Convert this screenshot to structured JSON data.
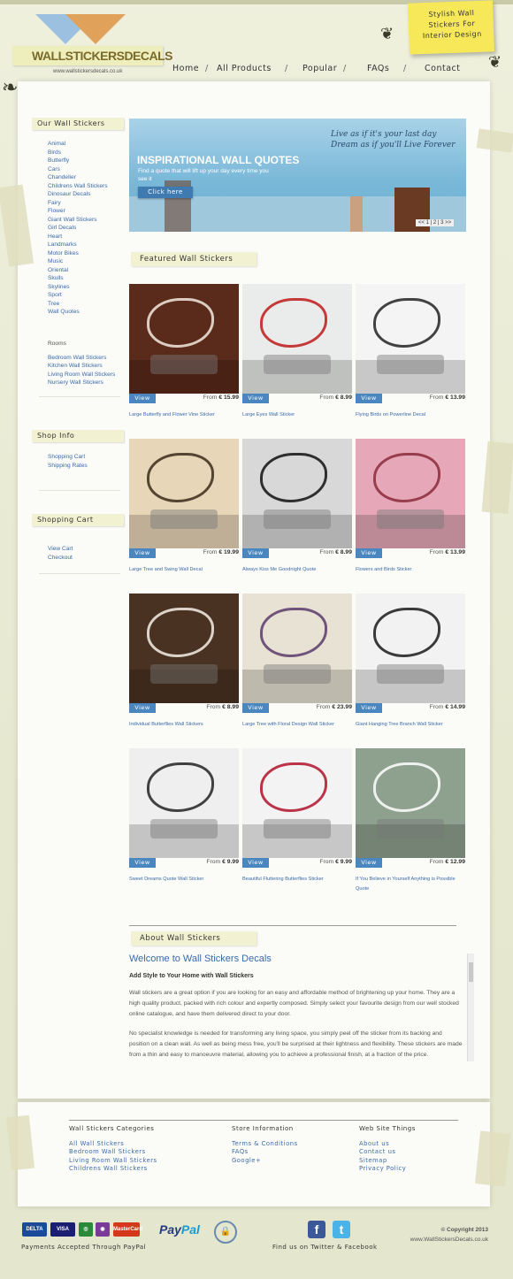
{
  "header": {
    "logo_text": "WALLSTICKERSDECALS",
    "logo_url": "www.wallstickersdecals.co.uk",
    "postit": "Stylish Wall Stickers For Interior Design",
    "nav": [
      "Home",
      "All Products",
      "Popular",
      "FAQs",
      "Contact"
    ]
  },
  "sidebar": {
    "categories_title": "Our Wall Stickers",
    "categories": [
      "Animal",
      "Birds",
      "Butterfly",
      "Cars",
      "Chandelier",
      "Childrens Wall Stickers",
      "Dinosaur Decals",
      "Fairy",
      "Flower",
      "Giant Wall Stickers",
      "Girl Decals",
      "Heart",
      "Landmarks",
      "Motor Bikes",
      "Music",
      "Oriental",
      "Skulls",
      "Skylines",
      "Sport",
      "Tree",
      "Wall Quotes"
    ],
    "rooms_title": "Rooms",
    "rooms": [
      "Bedroom Wall Stickers",
      "Kitchen Wall Stickers",
      "Living Room Wall Stickers",
      "Nursery Wall Stickers"
    ],
    "shop_title": "Shop Info",
    "shop": [
      "Shopping Cart",
      "Shipping Rates"
    ],
    "cart_title": "Shopping Cart",
    "cart": [
      "View Cart",
      "Checkout"
    ]
  },
  "banner": {
    "title": "INSPIRATIONAL WALL QUOTES",
    "subtitle": "Find a quote that will lift up your day every time you see it",
    "button": "Click here",
    "quote_line1": "Live as if it's your last day",
    "quote_line2": "Dream as if you'll Live Forever",
    "pager": "<< 1 | 2 | 3 >>"
  },
  "featured": {
    "title": "Featured Wall Stickers",
    "view_label": "View",
    "from_label": "From",
    "products": [
      {
        "name": "Large Butterfly and Flower Vine Sticker",
        "price": "€ 15.99",
        "bg": "#5a2a1a",
        "fg": "#f3e9e0"
      },
      {
        "name": "Large Eyes Wall Sticker",
        "price": "€ 8.99",
        "bg": "#e9ecea",
        "fg": "#c01a1a"
      },
      {
        "name": "Flying Birds on Powerline Decal",
        "price": "€ 13.99",
        "bg": "#f4f4f4",
        "fg": "#222222"
      },
      {
        "name": "Large Tree and Swing Wall Decal",
        "price": "€ 19.99",
        "bg": "#e8d6b8",
        "fg": "#3a2a1a"
      },
      {
        "name": "Always Kiss Me Goodnight Quote",
        "price": "€ 8.99",
        "bg": "#d8d8d8",
        "fg": "#111111"
      },
      {
        "name": "Flowers and Birds Sticker",
        "price": "€ 13.99",
        "bg": "#e6a8b8",
        "fg": "#8a2a3a"
      },
      {
        "name": "Individual Butterflies Wall Stickers",
        "price": "€ 8.99",
        "bg": "#4a3222",
        "fg": "#f4f0e8"
      },
      {
        "name": "Large Tree with Floral Design Wall Sticker",
        "price": "€ 23.99",
        "bg": "#e8e2d4",
        "fg": "#5a3a6a"
      },
      {
        "name": "Giant Hanging Tree Branch Wall Sticker",
        "price": "€ 14.99",
        "bg": "#f2f2f2",
        "fg": "#1a1a1a"
      },
      {
        "name": "Sweet Dreams Quote Wall Sticker",
        "price": "€ 9.99",
        "bg": "#efefef",
        "fg": "#222222"
      },
      {
        "name": "Beautiful Fluttering Butterflies Sticker",
        "price": "€ 9.99",
        "bg": "#f3f3f3",
        "fg": "#b0102a"
      },
      {
        "name": "If You Believe in Yourself Anything is Possible Quote",
        "price": "€ 12.99",
        "bg": "#8ea08e",
        "fg": "#ffffff"
      }
    ]
  },
  "about": {
    "title": "About Wall Stickers",
    "heading": "Welcome to Wall Stickers Decals",
    "subheading": "Add Style to Your Home with Wall Stickers",
    "p1": "Wall stickers are a great option if you are looking for an easy and affordable method of brightening up your home. They are a high quality product, packed with rich colour and expertly composed. Simply select your favourite design from our well stocked online catalogue, and have them delivered direct to your door.",
    "p2": "No specialist knowledge is needed for transforming any living space, you simply peel off the sticker from its backing and position on a clean wall. As well as being mess free, you'll be surprised at their lightness and flexibility. These stickers are made from a thin and easy to manoeuvre material, allowing you to achieve a professional finish, at a fraction of the price."
  },
  "footer": {
    "col1_title": "Wall Stickers Categories",
    "col1": [
      "All Wall Stickers",
      "Bedroom Wall Stickers",
      "Living Room Wall Stickers",
      "Childrens Wall Stickers"
    ],
    "col2_title": "Store Information",
    "col2": [
      "Terms & Conditions",
      "FAQs",
      "Google+"
    ],
    "col3_title": "Web Site Things",
    "col3": [
      "About us",
      "Contact us",
      "Sitemap",
      "Privacy Policy"
    ],
    "cards": [
      "DELTA",
      "VISA",
      "",
      "",
      "MasterCard"
    ],
    "paypal_pay": "Pay",
    "paypal_pal": "Pal",
    "payments_caption": "Payments Accepted Through PayPal",
    "social_caption": "Find us on Twitter & Facebook",
    "copyright": "© Copyright 2013",
    "domain": "www.WallStickersDecals.co.uk"
  },
  "colors": {
    "link": "#3a6aa8",
    "accent_blue": "#4a86c0",
    "postit": "#f7e85a",
    "tape": "#f2f2d2"
  }
}
